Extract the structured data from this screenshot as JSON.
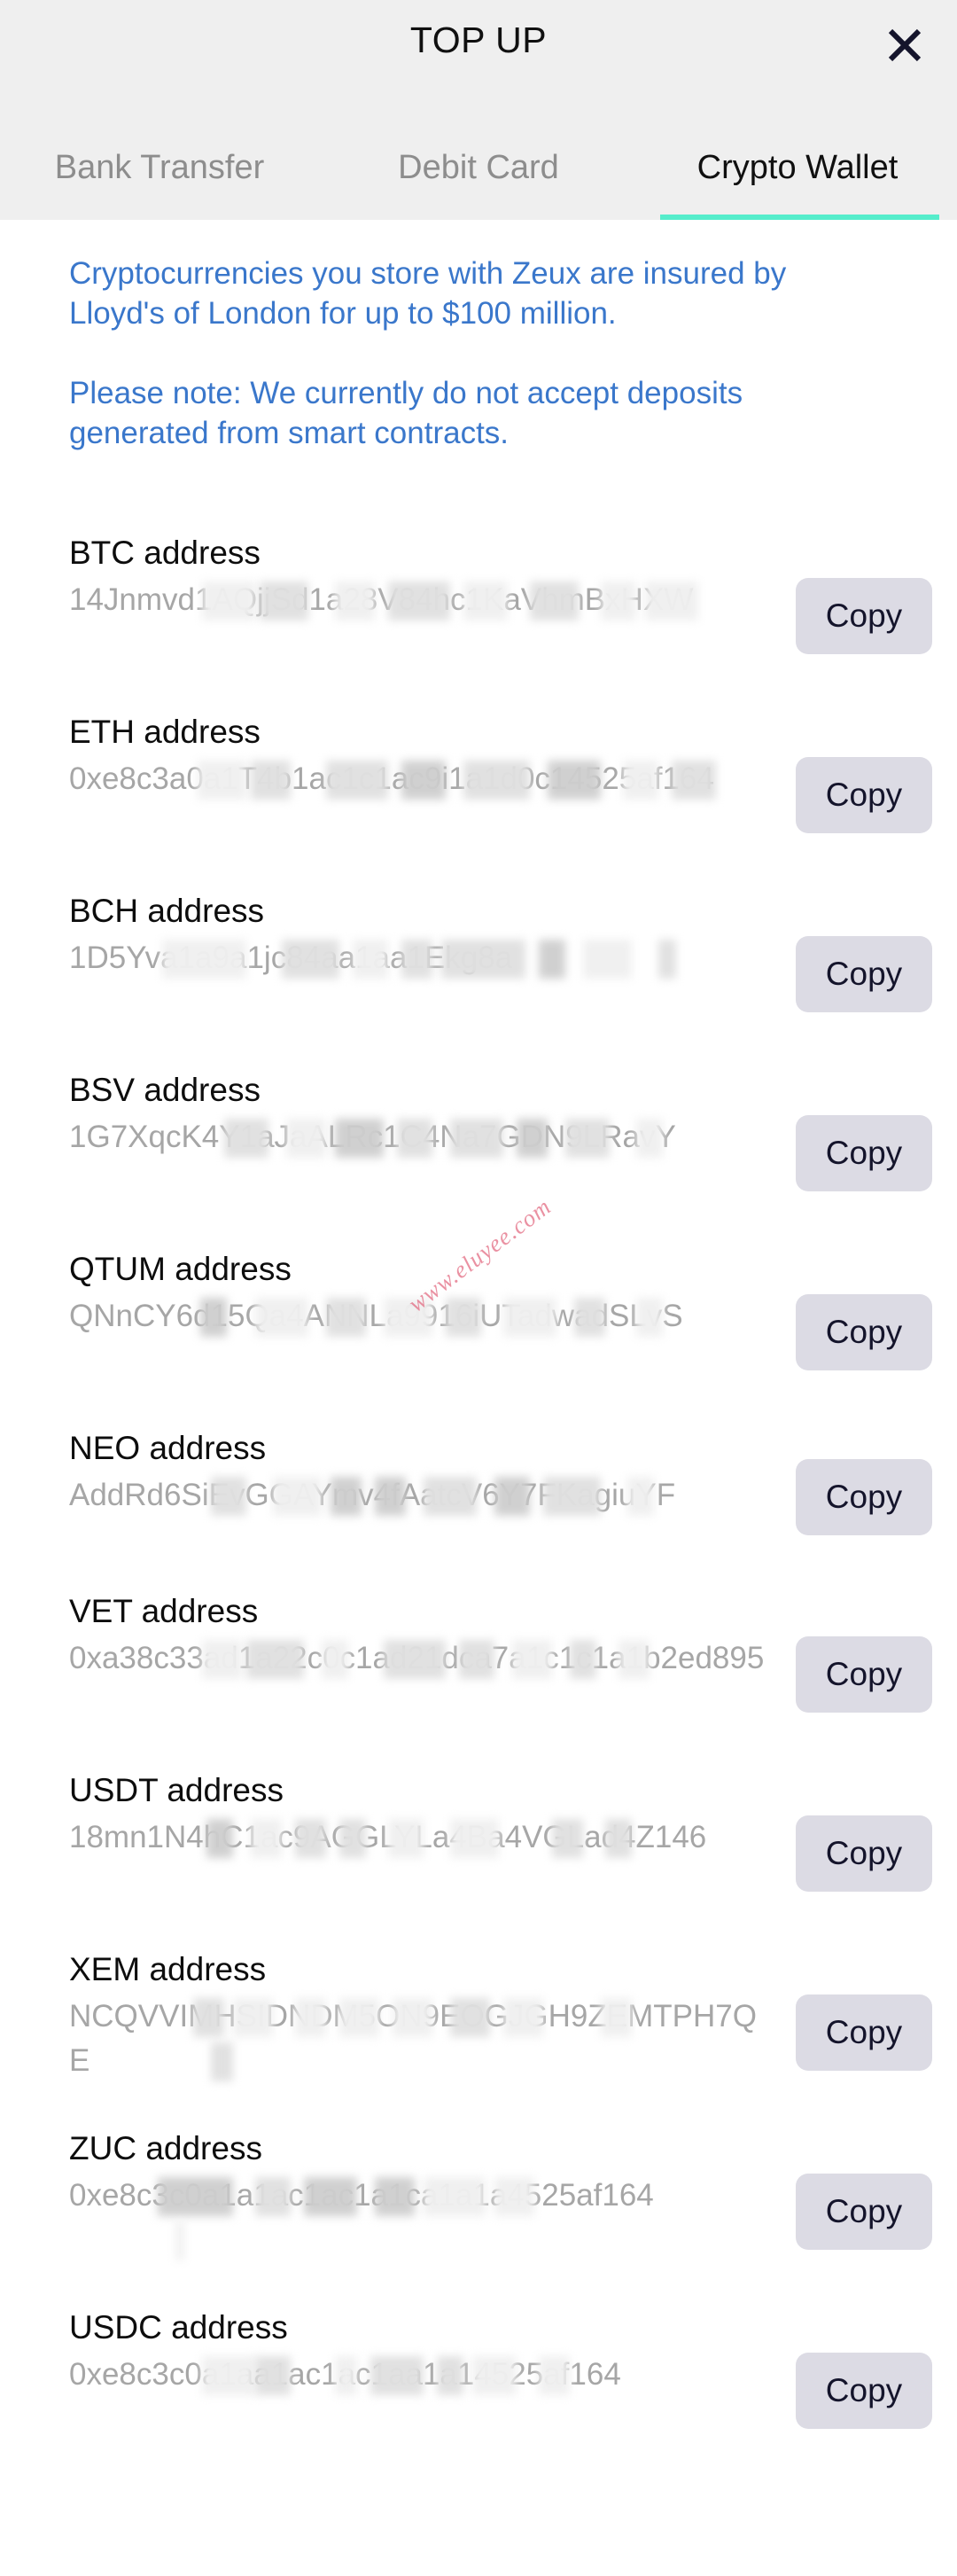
{
  "header": {
    "title": "TOP UP",
    "close_icon": "close-icon"
  },
  "tabs": [
    {
      "label": "Bank Transfer",
      "active": false
    },
    {
      "label": "Debit Card",
      "active": false
    },
    {
      "label": "Crypto Wallet",
      "active": true
    }
  ],
  "info": {
    "paragraph_1": "Cryptocurrencies you store with Zeux are insured by Lloyd's of London for up to $100 million.",
    "paragraph_2": "Please note: We currently do not accept deposits generated from smart contracts."
  },
  "copy_label": "Copy",
  "watermark": "www.eluyee.com",
  "colors": {
    "header_bg": "#efefef",
    "active_tab_underline": "#55edcb",
    "info_text": "#3a77cb",
    "copy_button_bg": "#dcdbe4",
    "copy_button_text": "#14142b",
    "label_text": "#0d0d0d",
    "address_text": "#a6a6a6",
    "inactive_tab_text": "#8d8d8d"
  },
  "addresses": [
    {
      "label": "BTC address",
      "value": "14Jnmvd1AQjjSd1a28V84hc1KaVhmBxHXW",
      "lines": 2
    },
    {
      "label": "ETH address",
      "value": "0xe8c3a0a1T4b1ac1c1ac9i1a1d0c14525af164",
      "lines": 2
    },
    {
      "label": "BCH address",
      "value": "1D5Yva1a9a1jc84aa1aa1Ekg8a",
      "lines": 2
    },
    {
      "label": "BSV address",
      "value": "1G7XqcK4Y1aJaALRc1C4Na7GDN9LRavY",
      "lines": 2
    },
    {
      "label": "QTUM address",
      "value": "QNnCY6d15Qa4ANNLa9916iUTadwadSLvS",
      "lines": 2
    },
    {
      "label": "NEO address",
      "value": "AddRd6SiEvGGAYmv4fAatcV6Y7FKagiuYF",
      "lines": 1
    },
    {
      "label": "VET address",
      "value": "0xa38c33ad1a22c0c1ad21dca7a1c1c1a1b2ed895",
      "lines": 2
    },
    {
      "label": "USDT address",
      "value": "18mn1N4hC1ac9AGGLYLa4Ba4VGLad4Z146",
      "lines": 2
    },
    {
      "label": "XEM address",
      "value": "NCQVVIMHSIDNDM5ON9EOGJGH9ZEMTPH7QE",
      "lines": 2
    },
    {
      "label": "ZUC address",
      "value": "0xe8c3c0a1a1ac1ac1a1ca1a1a4525af164",
      "lines": 2
    },
    {
      "label": "USDC address",
      "value": "0xe8c3c0a1aa1ac1ac1aa1a14525af164",
      "lines": 2
    }
  ]
}
